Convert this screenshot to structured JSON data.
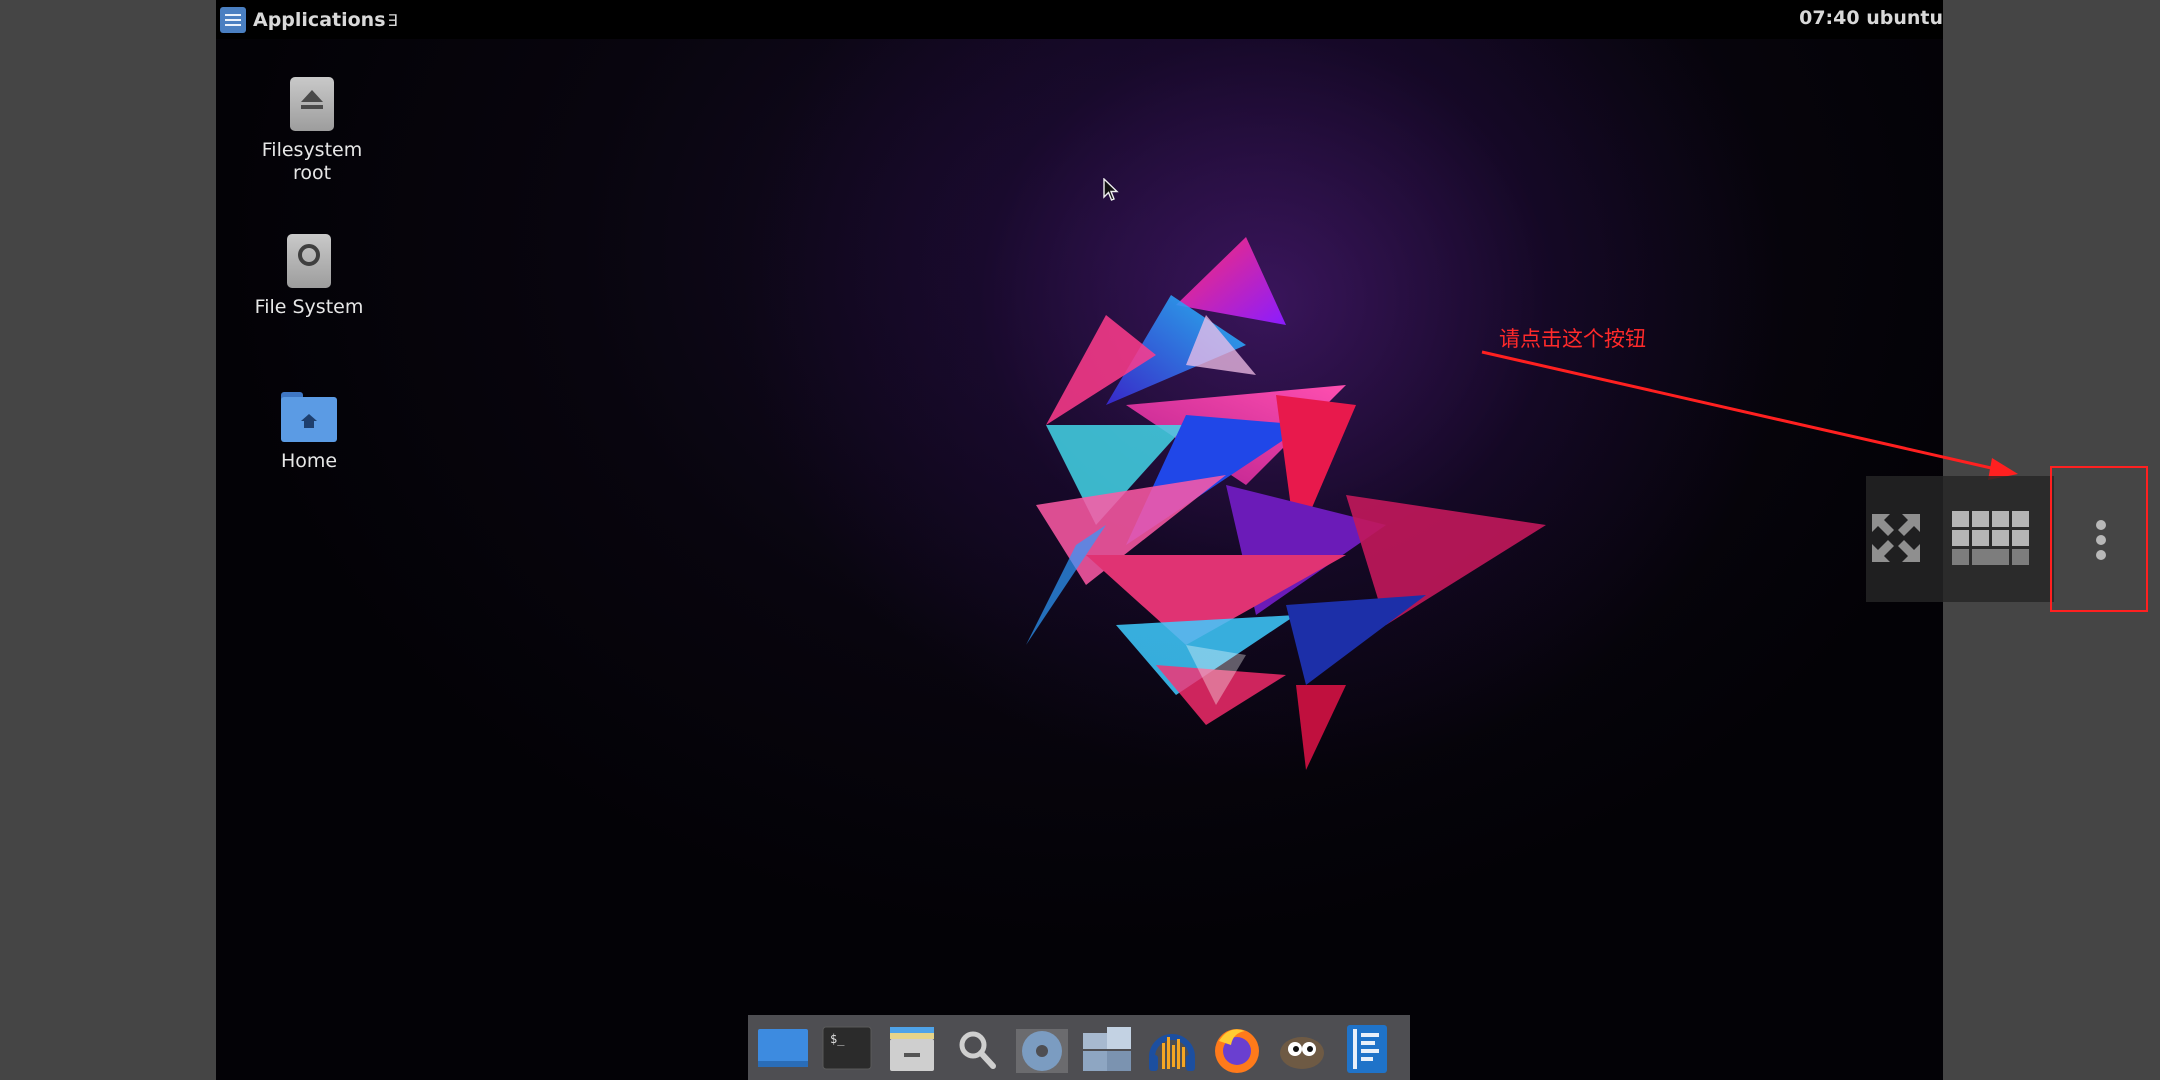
{
  "topbar": {
    "applications_label": "Applications",
    "overflow_glyph": "∃",
    "clock": "07:40",
    "user": "ubuntu"
  },
  "desktop_icons": [
    {
      "label": "Filesystem root",
      "icon": "eject-drive-icon"
    },
    {
      "label": "File System",
      "icon": "harddisk-icon"
    },
    {
      "label": "Home",
      "icon": "home-folder-icon"
    }
  ],
  "annotation": {
    "text": "请点击这个按钮",
    "color": "#ff2a2a"
  },
  "controls": [
    {
      "name": "fullscreen-button",
      "icon": "expand-arrows-icon"
    },
    {
      "name": "keyboard-button",
      "icon": "keyboard-grid-icon"
    },
    {
      "name": "more-options-button",
      "icon": "vertical-dots-icon"
    }
  ],
  "dock": [
    "show-desktop-icon",
    "terminal-icon",
    "file-manager-icon",
    "search-icon",
    "disc-icon",
    "files-icon",
    "audacity-icon",
    "firefox-icon",
    "gimp-icon",
    "text-editor-icon"
  ],
  "colors": {
    "accent_red": "#ff2020",
    "menu_blue": "#4a7fc1",
    "folder_blue": "#5b9be4"
  }
}
